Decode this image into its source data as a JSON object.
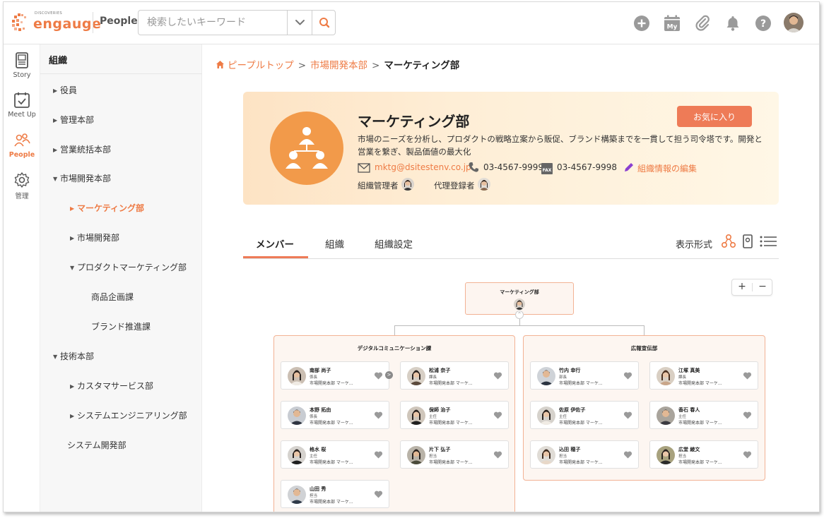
{
  "header": {
    "logo_tagline": "DISCOVERIES",
    "logo_brand": "engauge",
    "section": "People",
    "search_placeholder": "検索したいキーワード",
    "icons": [
      "plus-circle-icon",
      "calendar-my-icon",
      "paperclip-icon",
      "bell-icon",
      "help-icon"
    ],
    "calendar_label": "My"
  },
  "rail": {
    "items": [
      {
        "label": "Story",
        "icon": "story-icon"
      },
      {
        "label": "Meet Up",
        "icon": "meetup-icon"
      },
      {
        "label": "People",
        "icon": "people-icon",
        "active": true
      },
      {
        "label": "管理",
        "icon": "settings-gear-icon"
      }
    ]
  },
  "tree": {
    "title": "組織",
    "items": [
      {
        "label": "役員",
        "arrow": "▶"
      },
      {
        "label": "管理本部",
        "arrow": "▶"
      },
      {
        "label": "営業統括本部",
        "arrow": "▶"
      },
      {
        "label": "市場開発本部",
        "arrow": "▼"
      },
      {
        "label": "マーケティング部",
        "arrow": "▶",
        "active": true
      },
      {
        "label": "市場開発部",
        "arrow": "▶"
      },
      {
        "label": "プロダクトマーケティング部",
        "arrow": "▼"
      },
      {
        "label": "商品企画課",
        "arrow": ""
      },
      {
        "label": "ブランド推進課",
        "arrow": ""
      },
      {
        "label": "技術本部",
        "arrow": "▼"
      },
      {
        "label": "カスタマサービス部",
        "arrow": "▶"
      },
      {
        "label": "システムエンジニアリング部",
        "arrow": "▶"
      },
      {
        "label": "システム開発部",
        "arrow": ""
      }
    ]
  },
  "breadcrumb": {
    "items": [
      "ピープルトップ",
      "市場開発本部"
    ],
    "separator": ">",
    "current": "マーケティング部"
  },
  "org": {
    "name": "マーケティング部",
    "favorite_label": "お気に入り",
    "description": "市場のニーズを分析し、プロダクトの戦略立案から販促、ブランド構築までを一貫して担う司令塔です。開発と営業を繋ぎ、製品価値の最大化",
    "email": "mktg@dsitestenv.co.jp",
    "phone": "03-4567-9999",
    "fax_label": "FAX",
    "fax": "03-4567-9998",
    "edit_label": "組織情報の編集",
    "admin_label": "組織管理者",
    "deputy_label": "代理登録者"
  },
  "tabs": {
    "items": [
      "メンバー",
      "組織",
      "組織設定"
    ],
    "active": 0,
    "view_label": "表示形式"
  },
  "zoom": {
    "plus": "+",
    "minus": "−"
  },
  "chart": {
    "root": "マーケティング部",
    "collapse": "^",
    "groups": [
      {
        "title": "デジタルコミュニケーション課",
        "members": [
          {
            "name": "南部 尚子",
            "role": "係長",
            "dept": "市場開発本部 マーケ..."
          },
          {
            "name": "松浦 奈子",
            "role": "課長",
            "dept": "市場開発本部 マーケ..."
          },
          {
            "name": "本野 拓由",
            "role": "係長",
            "dept": "市場開発本部 マーケ..."
          },
          {
            "name": "保師 治子",
            "role": "主任",
            "dept": "市場開発本部 マーケ..."
          },
          {
            "name": "格水 桜",
            "role": "主任",
            "dept": "市場開発本部 マーケ..."
          },
          {
            "name": "片下 弘子",
            "role": "担当",
            "dept": "市場開発本部 マーケ..."
          },
          {
            "name": "山田 秀",
            "role": "担当",
            "dept": "市場開発本部 マーケ..."
          }
        ]
      },
      {
        "title": "広報宣伝部",
        "members": [
          {
            "name": "竹内 幸行",
            "role": "部長",
            "dept": "市場開発本部 マーケ..."
          },
          {
            "name": "江塚 真美",
            "role": "課長",
            "dept": "市場開発本部 マーケ..."
          },
          {
            "name": "佐原 伊佐子",
            "role": "主任",
            "dept": "市場開発本部 マーケ..."
          },
          {
            "name": "香石 春人",
            "role": "主任",
            "dept": "市場開発本部 マーケ..."
          },
          {
            "name": "込田 穂子",
            "role": "担当",
            "dept": "市場開発本部 マーケ..."
          },
          {
            "name": "広堂 綾文",
            "role": "担当",
            "dept": "市場開発本部 マーケ..."
          }
        ]
      }
    ],
    "more_label": ">"
  },
  "colors": {
    "accent": "#ee7b45",
    "button": "#ee7b57",
    "node_border": "#f2b294"
  }
}
